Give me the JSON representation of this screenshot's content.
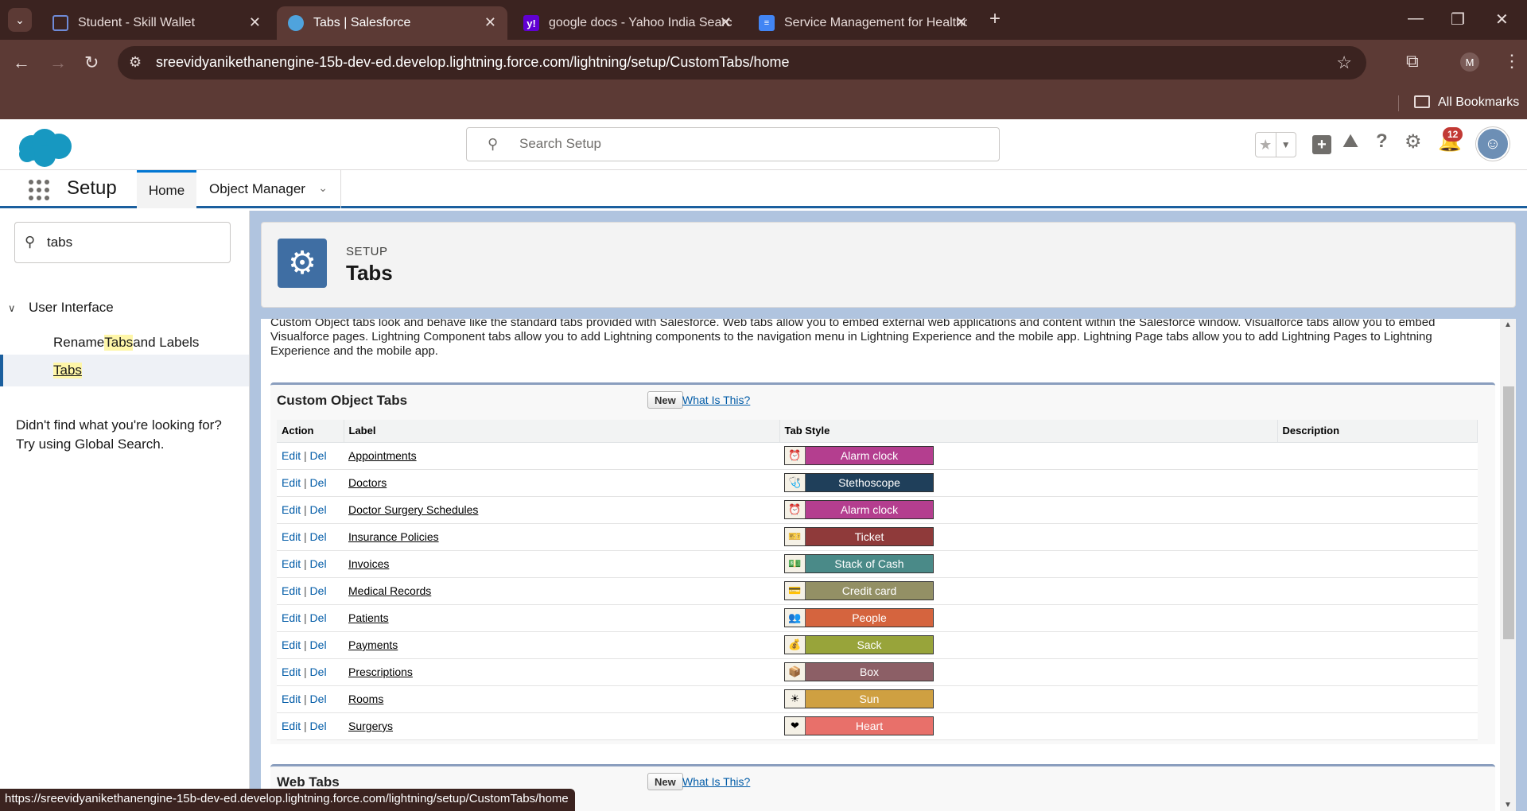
{
  "browser": {
    "tabs": [
      {
        "title": "Student - Skill Wallet",
        "favicon": "skill-wallet-icon"
      },
      {
        "title": "Tabs | Salesforce",
        "favicon": "salesforce-cloud-icon",
        "active": true
      },
      {
        "title": "google docs - Yahoo India Search",
        "favicon": "yahoo-icon"
      },
      {
        "title": "Service Management for Healthcare",
        "favicon": "docs-icon"
      }
    ],
    "url": "sreevidyanikethanengine-15b-dev-ed.develop.lightning.force.com/lightning/setup/CustomTabs/home",
    "profile_initial": "M",
    "bookmarks_label": "All Bookmarks",
    "status_url": "https://sreevidyanikethanengine-15b-dev-ed.develop.lightning.force.com/lightning/setup/CustomTabs/home"
  },
  "sf_header": {
    "search_placeholder": "Search Setup",
    "notification_count": "12"
  },
  "setup_nav": {
    "title": "Setup",
    "tabs": [
      "Home",
      "Object Manager"
    ]
  },
  "sidebar": {
    "quick_find_value": "tabs",
    "group": "User Interface",
    "items": [
      {
        "pre": "Rename ",
        "hl": "Tabs",
        "post": " and Labels"
      },
      {
        "pre": "",
        "hl": "Tabs",
        "post": ""
      }
    ],
    "not_found_line1": "Didn't find what you're looking for?",
    "not_found_line2": "Try using Global Search."
  },
  "page": {
    "eyebrow": "SETUP",
    "title": "Tabs",
    "description": "Custom Object tabs look and behave like the standard tabs provided with Salesforce. Web tabs allow you to embed external web applications and content within the Salesforce window. Visualforce tabs allow you to embed Visualforce pages. Lightning Component tabs allow you to add Lightning components to the navigation menu in Lightning Experience and the mobile app. Lightning Page tabs allow you to add Lightning Pages to Lightning Experience and the mobile app."
  },
  "custom_object_tabs": {
    "title": "Custom Object Tabs",
    "new_label": "New",
    "what_is_this": "What Is This?",
    "columns": [
      "Action",
      "Label",
      "Tab Style",
      "Description"
    ],
    "edit_label": "Edit",
    "del_label": "Del",
    "rows": [
      {
        "label": "Appointments",
        "style": "Alarm clock",
        "color": "#b43e8f",
        "icon": "alarm-clock-icon",
        "glyph": "⏰"
      },
      {
        "label": "Doctors",
        "style": "Stethoscope",
        "color": "#1f3f5a",
        "icon": "stethoscope-icon",
        "glyph": "🩺"
      },
      {
        "label": "Doctor Surgery Schedules",
        "style": "Alarm clock",
        "color": "#b43e8f",
        "icon": "alarm-clock-icon",
        "glyph": "⏰"
      },
      {
        "label": "Insurance Policies",
        "style": "Ticket",
        "color": "#8f3a3a",
        "icon": "ticket-icon",
        "glyph": "🎫"
      },
      {
        "label": "Invoices",
        "style": "Stack of Cash",
        "color": "#4a8a88",
        "icon": "cash-icon",
        "glyph": "💵"
      },
      {
        "label": "Medical Records",
        "style": "Credit card",
        "color": "#939065",
        "icon": "credit-card-icon",
        "glyph": "💳"
      },
      {
        "label": "Patients",
        "style": "People",
        "color": "#d5643e",
        "icon": "people-icon",
        "glyph": "👥"
      },
      {
        "label": "Payments",
        "style": "Sack",
        "color": "#98a43a",
        "icon": "sack-icon",
        "glyph": "💰"
      },
      {
        "label": "Prescriptions",
        "style": "Box",
        "color": "#8c5f66",
        "icon": "box-icon",
        "glyph": "📦"
      },
      {
        "label": "Rooms",
        "style": "Sun",
        "color": "#cfa041",
        "icon": "sun-icon",
        "glyph": "☀"
      },
      {
        "label": "Surgerys",
        "style": "Heart",
        "color": "#e8706a",
        "icon": "heart-icon",
        "glyph": "❤"
      }
    ]
  },
  "web_tabs": {
    "title": "Web Tabs",
    "new_label": "New",
    "what_is_this": "What Is This?"
  }
}
